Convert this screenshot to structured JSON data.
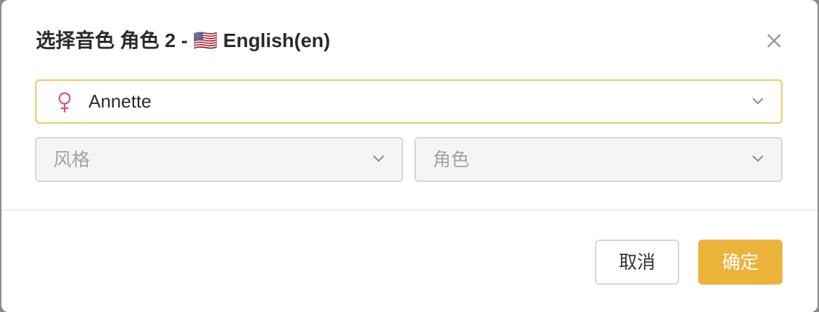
{
  "dialog": {
    "title_prefix": "选择音色 角色 2 - ",
    "flag": "🇺🇸",
    "title_lang": " English(en)"
  },
  "voice_select": {
    "value": "Annette",
    "gender_icon": "female-icon",
    "gender_color": "#d9507a"
  },
  "style_select": {
    "placeholder": "风格"
  },
  "role_select": {
    "placeholder": "角色"
  },
  "footer": {
    "cancel_label": "取消",
    "ok_label": "确定"
  },
  "colors": {
    "accent": "#ecb33b",
    "focus_border": "#ecc862"
  }
}
